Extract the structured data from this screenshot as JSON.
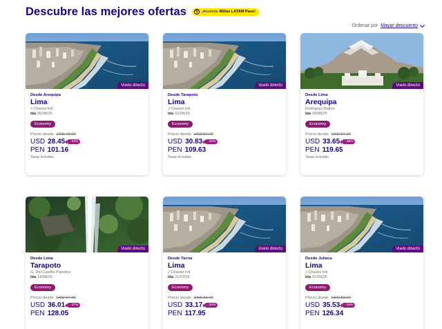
{
  "header": {
    "title": "Descubre las mejores ofertas",
    "promo_text": "¡Acumula",
    "promo_bold": "Millas LATAM Pass!",
    "promo_icon": "miles-icon"
  },
  "sort": {
    "label": "Ordenar por",
    "selected": "Mayor descuento"
  },
  "colors": {
    "primary": "#1b0088",
    "badge_purple": "#5c0b7a",
    "cabin_magenta": "#8c1a6e",
    "promo_yellow": "#ffe600"
  },
  "cards": [
    {
      "from": "Desde Arequipa",
      "destination": "Lima",
      "airport": "J Chavez Intl.",
      "date_label": "Ida",
      "date": "06/08/25",
      "cabin": "Economy",
      "price_from_label": "Precio desde",
      "old_price": "USD 49.00",
      "usd_label": "USD",
      "usd": "28.45",
      "discount": "-42%",
      "pen_label": "PEN",
      "pen": "101.16",
      "taxes": "Tasas incluidas",
      "badge": "Vuelo directo",
      "image": "lima-coast"
    },
    {
      "from": "Desde Tarapoto",
      "destination": "Lima",
      "airport": "J Chavez Intl.",
      "date_label": "Ida",
      "date": "02/09/25",
      "cabin": "Economy",
      "price_from_label": "Precio desde",
      "old_price": "USD 51.00",
      "usd_label": "USD",
      "usd": "30.83",
      "discount": "-40%",
      "pen_label": "PEN",
      "pen": "109.63",
      "taxes": "Tasas incluidas",
      "badge": "Vuelo directo",
      "image": "lima-coast"
    },
    {
      "from": "Desde Lima",
      "destination": "Arequipa",
      "airport": "Rodriguez Ballon",
      "date_label": "Ida",
      "date": "20/08/25",
      "cabin": "Economy",
      "price_from_label": "Precio desde",
      "old_price": "USD 54.00",
      "usd_label": "USD",
      "usd": "33.65",
      "discount": "-38%",
      "pen_label": "PEN",
      "pen": "119.65",
      "taxes": "Tasas incluidas",
      "badge": "Vuelo directo",
      "image": "arequipa-volcano"
    },
    {
      "from": "Desde Lima",
      "destination": "Tarapoto",
      "airport": "G. Del Castillo Paredes",
      "date_label": "Ida",
      "date": "14/08/25",
      "cabin": "Economy",
      "price_from_label": "Precio desde",
      "old_price": "USD 57.00",
      "usd_label": "USD",
      "usd": "36.01",
      "discount": "-37%",
      "pen_label": "PEN",
      "pen": "128.05",
      "taxes": "",
      "badge": "Vuelo directo",
      "image": "tarapoto-waterfall"
    },
    {
      "from": "Desde Tacna",
      "destination": "Lima",
      "airport": "J Chavez Intl.",
      "date_label": "Ida",
      "date": "21/07/25",
      "cabin": "Economy",
      "price_from_label": "Precio desde",
      "old_price": "USD 50.00",
      "usd_label": "USD",
      "usd": "33.17",
      "discount": "-34%",
      "pen_label": "PEN",
      "pen": "117.95",
      "taxes": "",
      "badge": "Vuelo directo",
      "image": "lima-coast"
    },
    {
      "from": "Desde Juliaca",
      "destination": "Lima",
      "airport": "J Chavez Intl.",
      "date_label": "Ida",
      "date": "01/09/25",
      "cabin": "Economy",
      "price_from_label": "Precio desde",
      "old_price": "USD 53.00",
      "usd_label": "USD",
      "usd": "35.53",
      "discount": "-33%",
      "pen_label": "PEN",
      "pen": "126.34",
      "taxes": "",
      "badge": "Vuelo directo",
      "image": "lima-coast"
    }
  ]
}
